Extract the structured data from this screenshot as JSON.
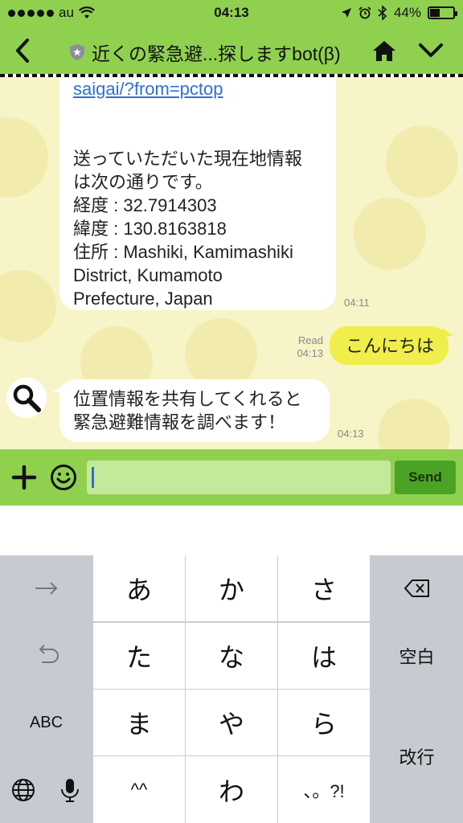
{
  "status": {
    "carrier": "au",
    "time": "04:13",
    "battery": "44%",
    "battery_level": 0.44
  },
  "header": {
    "title": "近くの緊急避...探しますbot(β)"
  },
  "messages": [
    {
      "from": "bot",
      "link": "saigai/?from=pctop",
      "text": "送っていただいた現在地情報\nは次の通りです。\n経度 : 32.7914303\n緯度 : 130.8163818\n住所 : Mashiki, Kamimashiki\nDistrict, Kumamoto\nPrefecture, Japan",
      "time": "04:11"
    },
    {
      "from": "me",
      "text": "こんにちは",
      "read": "Read",
      "time": "04:13"
    },
    {
      "from": "bot",
      "text": "位置情報を共有してくれると\n緊急避難情報を調べます！",
      "time": "04:13"
    }
  ],
  "composer": {
    "send_label": "Send"
  },
  "keyboard": {
    "row1": [
      "あ",
      "か",
      "さ"
    ],
    "row2": [
      "た",
      "な",
      "は"
    ],
    "row3": [
      "ま",
      "や",
      "ら"
    ],
    "row4": [
      "^^",
      "わ",
      "、。?!"
    ],
    "abc": "ABC",
    "space": "空白",
    "return": "改行"
  },
  "colors": {
    "header": "#8fd14f",
    "chat_bg": "#f7f4c8",
    "my_bubble": "#f0ee4a",
    "send_button": "#4aa324"
  }
}
